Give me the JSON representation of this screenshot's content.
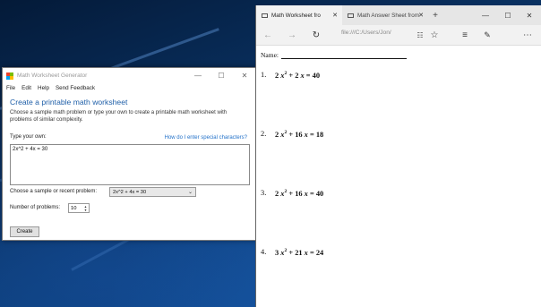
{
  "generator": {
    "title": "Math Worksheet Generator",
    "menu": [
      "File",
      "Edit",
      "Help",
      "Send Feedback"
    ],
    "heading": "Create a printable math worksheet",
    "description": "Choose a sample math problem or type your own to create a printable math worksheet with problems of similar complexity.",
    "type_label": "Type your own:",
    "help_link": "How do I enter special characters?",
    "problem_input": "2x^2 + 4x = 30",
    "sample_label": "Choose a sample or recent problem:",
    "sample_value": "2x^2 + 4x = 30",
    "count_label": "Number of problems:",
    "count_value": "10",
    "create_label": "Create",
    "icons": {
      "minimize": "minimize-icon",
      "maximize": "maximize-icon",
      "close": "close-icon"
    }
  },
  "browser": {
    "tabs": [
      {
        "label": "Math Worksheet fro",
        "active": true
      },
      {
        "label": "Math Answer Sheet from",
        "active": false
      }
    ],
    "url": "file:///C:/Users/Jon/",
    "name_label": "Name:",
    "problems": [
      {
        "num": "1.",
        "a": "2",
        "b": "2",
        "rhs": "40"
      },
      {
        "num": "2.",
        "a": "2",
        "b": "16",
        "rhs": "18"
      },
      {
        "num": "3.",
        "a": "2",
        "b": "16",
        "rhs": "40"
      },
      {
        "num": "4.",
        "a": "3",
        "b": "21",
        "rhs": "24"
      }
    ]
  },
  "colors": {
    "accent": "#1f5fa8",
    "link": "#1f6fc8"
  }
}
